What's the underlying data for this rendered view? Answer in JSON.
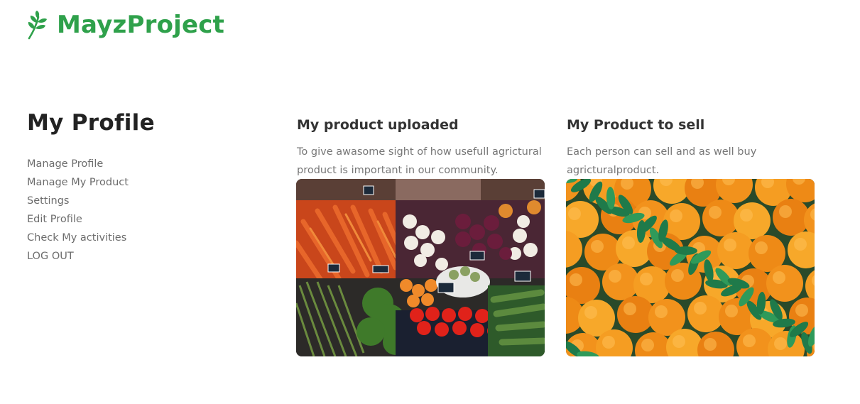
{
  "brand": {
    "name": "MayzProject",
    "icon": "leaf-icon",
    "color": "#2fa14b"
  },
  "sidebar": {
    "title": "My Profile",
    "items": [
      {
        "label": "Manage Profile"
      },
      {
        "label": "Manage My Product"
      },
      {
        "label": "Settings"
      },
      {
        "label": "Edit Profile"
      },
      {
        "label": "Check My activities"
      },
      {
        "label": "LOG OUT"
      }
    ]
  },
  "cards": [
    {
      "title": "My product uploaded",
      "description": "To give awasome sight of how usefull agrictural product is important in our community.",
      "image": "vegetable-market-photo"
    },
    {
      "title": "My Product to sell",
      "description": "Each person can sell and as well buy agricturalproduct.",
      "image": "oranges-photo"
    }
  ]
}
